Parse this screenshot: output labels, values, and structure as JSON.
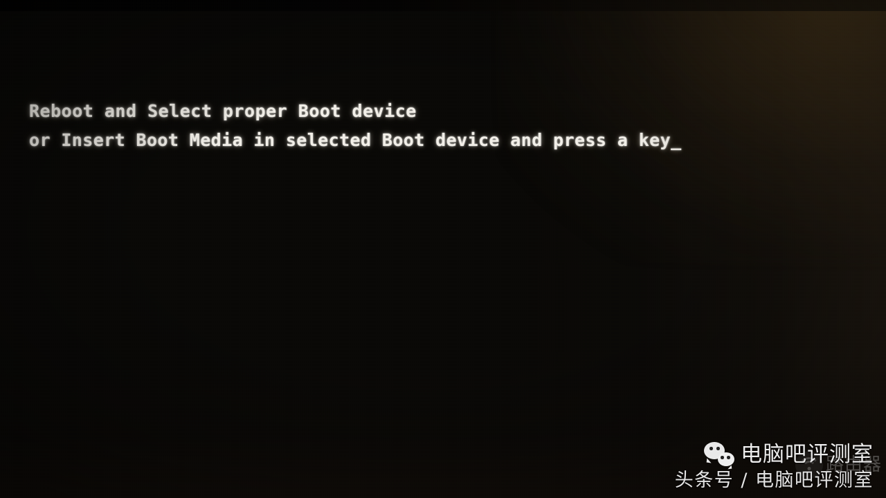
{
  "screen": {
    "kind": "bios-boot-error-screen",
    "background_color": "#090806",
    "text_color": "#f2efe8",
    "glow_color": "#967034"
  },
  "bios": {
    "line1": "Reboot and Select proper Boot device",
    "line2": "or Insert Boot Media in selected Boot device and press a key",
    "cursor": "_"
  },
  "watermark": {
    "icon": "wechat-icon",
    "title": "电脑吧评测室",
    "subtitle": "头条号 / 电脑吧评测室",
    "ghost": {
      "icon": "wifi-router-icon",
      "text": "路由器"
    }
  }
}
